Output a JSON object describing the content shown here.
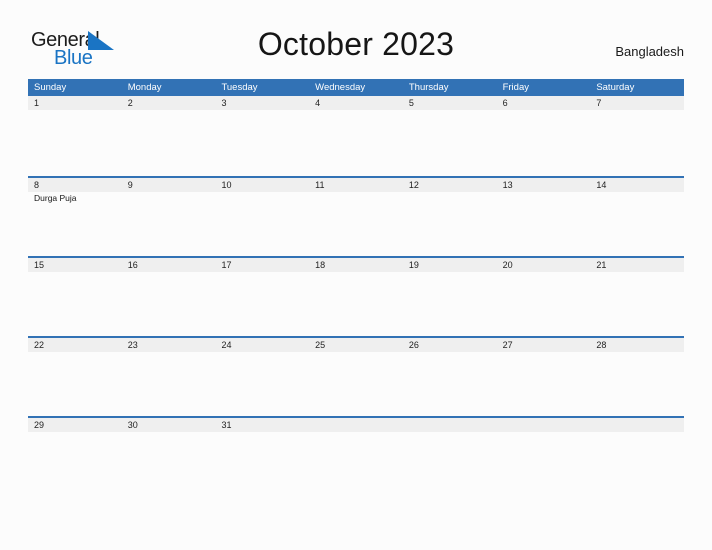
{
  "logo": {
    "word_top": "General",
    "word_bottom": "Blue",
    "flag_icon": "blue-triangle-flag-icon",
    "brand_color": "#1a74c4"
  },
  "header": {
    "title": "October 2023",
    "country": "Bangladesh"
  },
  "colors": {
    "header_blue": "#3272b5",
    "band_gray": "#efefef",
    "page_background": "#fcfcfc",
    "text": "#1a1a1a"
  },
  "calendar": {
    "month": "October",
    "year": "2023",
    "weekday_headers": [
      "Sunday",
      "Monday",
      "Tuesday",
      "Wednesday",
      "Thursday",
      "Friday",
      "Saturday"
    ],
    "weeks": [
      {
        "days": [
          {
            "num": "1",
            "events": []
          },
          {
            "num": "2",
            "events": []
          },
          {
            "num": "3",
            "events": []
          },
          {
            "num": "4",
            "events": []
          },
          {
            "num": "5",
            "events": []
          },
          {
            "num": "6",
            "events": []
          },
          {
            "num": "7",
            "events": []
          }
        ]
      },
      {
        "days": [
          {
            "num": "8",
            "events": [
              "Durga Puja"
            ]
          },
          {
            "num": "9",
            "events": []
          },
          {
            "num": "10",
            "events": []
          },
          {
            "num": "11",
            "events": []
          },
          {
            "num": "12",
            "events": []
          },
          {
            "num": "13",
            "events": []
          },
          {
            "num": "14",
            "events": []
          }
        ]
      },
      {
        "days": [
          {
            "num": "15",
            "events": []
          },
          {
            "num": "16",
            "events": []
          },
          {
            "num": "17",
            "events": []
          },
          {
            "num": "18",
            "events": []
          },
          {
            "num": "19",
            "events": []
          },
          {
            "num": "20",
            "events": []
          },
          {
            "num": "21",
            "events": []
          }
        ]
      },
      {
        "days": [
          {
            "num": "22",
            "events": []
          },
          {
            "num": "23",
            "events": []
          },
          {
            "num": "24",
            "events": []
          },
          {
            "num": "25",
            "events": []
          },
          {
            "num": "26",
            "events": []
          },
          {
            "num": "27",
            "events": []
          },
          {
            "num": "28",
            "events": []
          }
        ]
      },
      {
        "days": [
          {
            "num": "29",
            "events": []
          },
          {
            "num": "30",
            "events": []
          },
          {
            "num": "31",
            "events": []
          },
          {
            "num": "",
            "events": []
          },
          {
            "num": "",
            "events": []
          },
          {
            "num": "",
            "events": []
          },
          {
            "num": "",
            "events": []
          }
        ]
      }
    ]
  }
}
